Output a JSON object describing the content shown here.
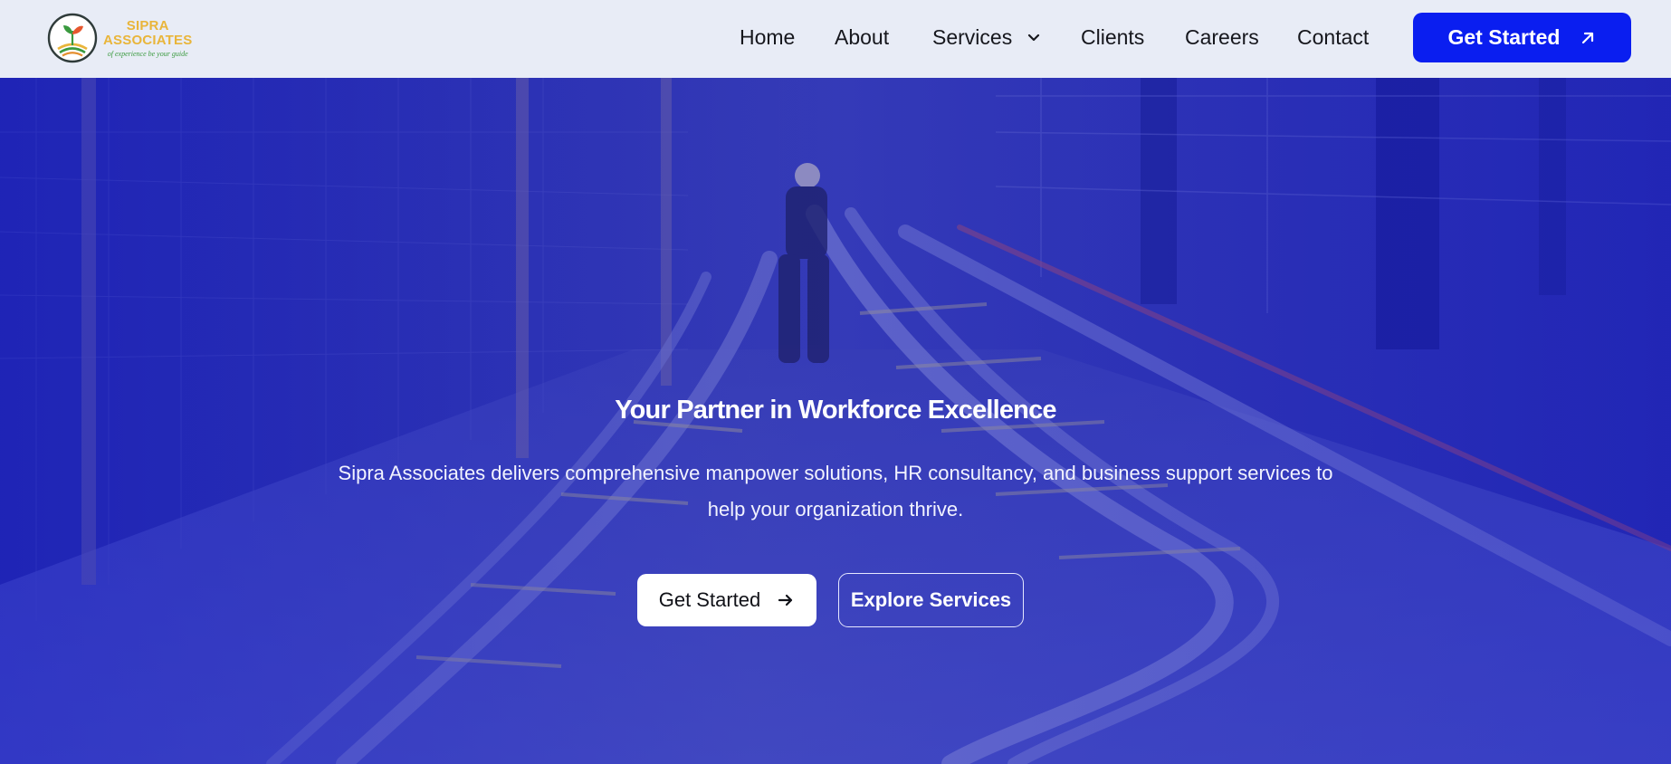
{
  "brand": {
    "name_line1": "SIPRA",
    "name_line2": "ASSOCIATES",
    "tagline": "of experience be your guide"
  },
  "nav": {
    "items": [
      {
        "label": "Home"
      },
      {
        "label": "About"
      },
      {
        "label": "Services"
      },
      {
        "label": "Clients"
      },
      {
        "label": "Careers"
      },
      {
        "label": "Contact"
      }
    ],
    "cta_label": "Get Started"
  },
  "hero": {
    "title": "Your Partner in Workforce Excellence",
    "description": "Sipra Associates delivers comprehensive manpower solutions, HR consultancy, and business support services to help your organization thrive.",
    "primary_label": "Get Started",
    "secondary_label": "Explore Services"
  },
  "colors": {
    "accent": "#0a1ef0",
    "hero_overlay": "#2a2fa8",
    "logo_gold": "#e9b53a",
    "logo_green": "#3a9a3f"
  },
  "icons": {
    "services_dropdown": "chevron-down-icon",
    "header_cta": "arrow-up-right-icon",
    "hero_primary": "arrow-right-icon"
  }
}
